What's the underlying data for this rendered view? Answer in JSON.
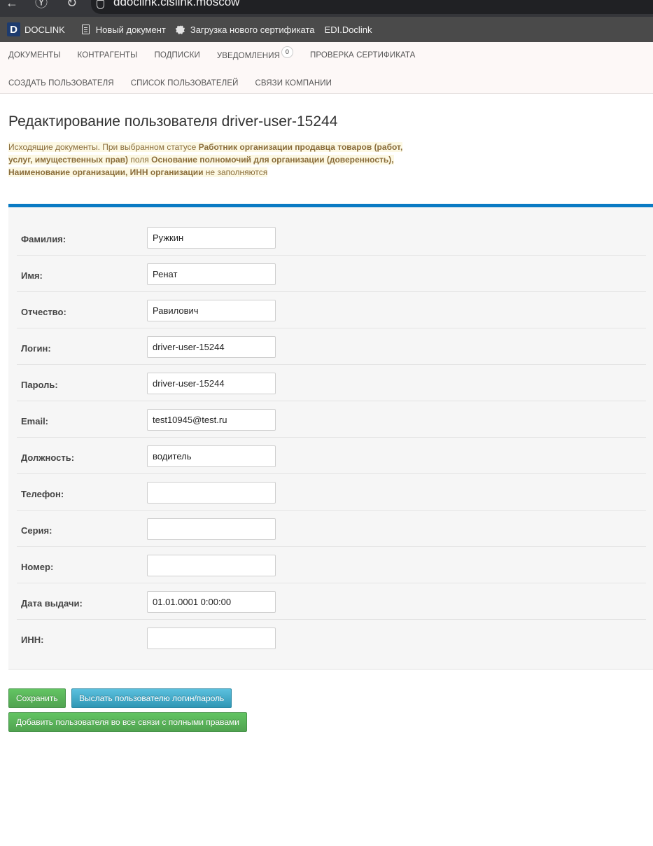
{
  "browser": {
    "url": "ddoclink.cislink.moscow",
    "back_glyph": "←",
    "yandex_glyph": "Ⓨ",
    "reload_glyph": "↻"
  },
  "bookmarks": {
    "logo_letter": "D",
    "items": [
      "DOCLINK",
      "Новый документ",
      "Загрузка нового сертификата",
      "EDI.Doclink"
    ]
  },
  "nav": {
    "row1": [
      "ДОКУМЕНТЫ",
      "КОНТРАГЕНТЫ",
      "ПОДПИСКИ",
      "УВЕДОМЛЕНИЯ",
      "ПРОВЕРКА СЕРТИФИКАТА"
    ],
    "notifications_count": "0",
    "row2": [
      "СОЗДАТЬ ПОЛЬЗОВАТЕЛЯ",
      "СПИСОК ПОЛЬЗОВАТЕЛЕЙ",
      "СВЯЗИ КОМПАНИИ"
    ]
  },
  "page": {
    "title": "Редактирование пользователя driver-user-15244"
  },
  "notice": {
    "t1": "Исходящие документы. При выбранном статусе ",
    "b1": "Работник организации продавца товаров (работ, услуг, имущественных прав)",
    "t2": " поля ",
    "b2": "Основание полномочий для организации (доверенность), Наименование организации, ИНН организации",
    "t3": " не заполняются"
  },
  "form": {
    "fields": [
      {
        "label": "Фамилия:",
        "value": "Ружкин"
      },
      {
        "label": "Имя:",
        "value": "Ренат"
      },
      {
        "label": "Отчество:",
        "value": "Равилович"
      },
      {
        "label": "Логин:",
        "value": "driver-user-15244"
      },
      {
        "label": "Пароль:",
        "value": "driver-user-15244"
      },
      {
        "label": "Email:",
        "value": "test10945@test.ru"
      },
      {
        "label": "Должность:",
        "value": "водитель"
      },
      {
        "label": "Телефон:",
        "value": ""
      },
      {
        "label": "Серия:",
        "value": ""
      },
      {
        "label": "Номер:",
        "value": ""
      },
      {
        "label": "Дата выдачи:",
        "value": "01.01.0001 0:00:00"
      },
      {
        "label": "ИНН:",
        "value": ""
      }
    ]
  },
  "buttons": {
    "save": "Сохранить",
    "send_credentials": "Выслать пользователю логин/пароль",
    "add_to_all_links": "Добавить пользователя во все связи с полными правами"
  },
  "colors": {
    "accent_blue": "#0a7bc4",
    "button_green": "#51a351",
    "button_blue": "#2f96b4",
    "notice_text": "#8a6d3b"
  }
}
